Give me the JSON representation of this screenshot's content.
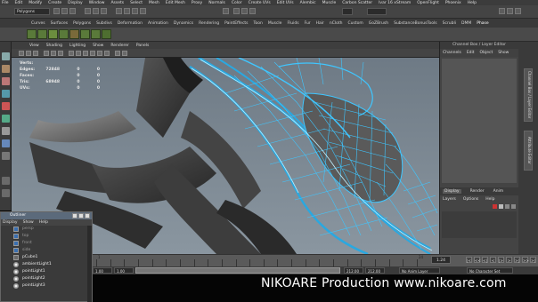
{
  "menubar": {
    "items": [
      "File",
      "Edit",
      "Modify",
      "Create",
      "Display",
      "Window",
      "Assets",
      "Select",
      "Mesh",
      "Edit Mesh",
      "Proxy",
      "Normals",
      "Color",
      "Create UVs",
      "Edit UVs",
      "Alembic",
      "Muscle",
      "Carbon Scatter",
      "Ivar 16 xStream",
      "OpenFlight",
      "Phoenix",
      "Help"
    ]
  },
  "statusline": {
    "mode": "Polygons"
  },
  "shelf": {
    "tabs": [
      "Curves",
      "Surfaces",
      "Polygons",
      "Subdivs",
      "Deformation",
      "Animation",
      "Dynamics",
      "Rendering",
      "PaintEffects",
      "Toon",
      "Muscle",
      "Fluids",
      "Fur",
      "Hair",
      "nCloth",
      "Custom",
      "GoZBrush",
      "SubstanceBonusTools",
      "Scrubli",
      "DMM",
      "Phase"
    ],
    "active_tab": "Phase"
  },
  "panel": {
    "menu": [
      "View",
      "Shading",
      "Lighting",
      "Show",
      "Renderer",
      "Panels"
    ]
  },
  "hud": {
    "rows": [
      {
        "label": "Verts:",
        "v1": "",
        "v2": "",
        "v3": ""
      },
      {
        "label": "Edges:",
        "v1": "72848",
        "v2": "0",
        "v3": "0"
      },
      {
        "label": "Faces:",
        "v1": "",
        "v2": "0",
        "v3": "0"
      },
      {
        "label": "Tris:",
        "v1": "68948",
        "v2": "0",
        "v3": "0"
      },
      {
        "label": "UVs:",
        "v1": "",
        "v2": "0",
        "v3": "0"
      }
    ]
  },
  "channelbox": {
    "title": "Channel Box / Layer Editor",
    "menu": [
      "Channels",
      "Edit",
      "Object",
      "Show"
    ],
    "layer_tabs": [
      "Display",
      "Render",
      "Anim"
    ],
    "active_layer_tab": "Display",
    "layer_menu": [
      "Layers",
      "Options",
      "Help"
    ]
  },
  "attribute_strip": {
    "tabs": [
      "Channel Box / Layer Editor",
      "Attribute Editor"
    ]
  },
  "timeslider": {
    "ticks": [
      "1",
      "",
      "",
      "",
      "",
      "",
      "",
      "",
      "",
      "",
      "",
      "",
      "",
      "",
      "",
      "",
      "",
      "",
      "",
      "",
      "",
      "",
      "",
      "24"
    ],
    "current_frame": "1.24"
  },
  "playback": {
    "buttons": [
      "|<",
      "<<",
      "<|",
      "<",
      "|>",
      ">",
      ">|",
      ">>",
      ">|"
    ]
  },
  "rangeslider": {
    "start": "1.00",
    "inner_start": "1.00",
    "inner_end": "212.00",
    "end": "212.00",
    "anim_layer": "No Anim Layer",
    "char_set": "No Character Set"
  },
  "watermark": {
    "text": "NIKOARE Production    www.nikoare.com"
  },
  "outliner": {
    "title": "Outliner",
    "menu": [
      "Display",
      "Show",
      "Help"
    ],
    "items": [
      {
        "label": "persp",
        "visible": false,
        "kind": "cam"
      },
      {
        "label": "top",
        "visible": false,
        "kind": "cam"
      },
      {
        "label": "front",
        "visible": false,
        "kind": "cam"
      },
      {
        "label": "side",
        "visible": false,
        "kind": "cam"
      },
      {
        "label": "pCube1",
        "visible": true,
        "kind": "mesh"
      },
      {
        "label": "ambientLight1",
        "visible": true,
        "kind": "light"
      },
      {
        "label": "pointLight1",
        "visible": true,
        "kind": "light"
      },
      {
        "label": "pointLight2",
        "visible": true,
        "kind": "light"
      },
      {
        "label": "pointLight3",
        "visible": true,
        "kind": "light"
      }
    ]
  },
  "colors": {
    "wireframe": "#3fc6ff",
    "mesh_dark": "#3c3c3c",
    "viewport_bg": "#7b8792"
  }
}
